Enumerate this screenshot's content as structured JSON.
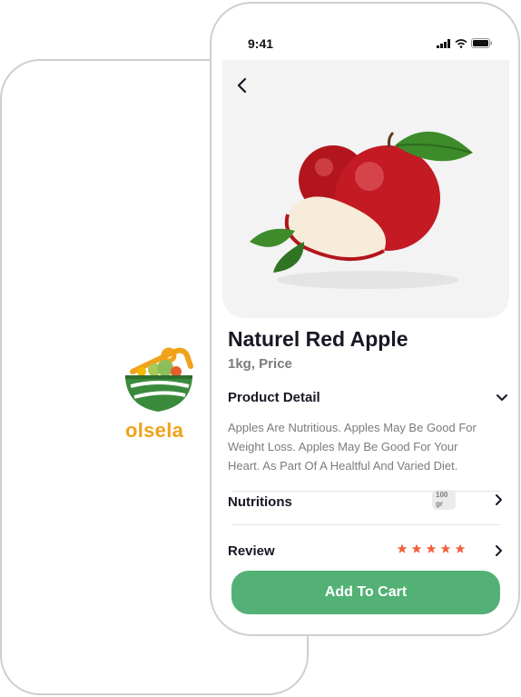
{
  "splash": {
    "brand": "olsela",
    "colors": {
      "brand_orange": "#f0a21a",
      "brand_green": "#3a8a3c"
    },
    "logo_icon": "basket-logo-icon"
  },
  "status_bar": {
    "time": "9:41",
    "icons": [
      "signal-icon",
      "wifi-icon",
      "battery-icon"
    ]
  },
  "product": {
    "name": "Naturel Red Apple",
    "unit_price": "1kg, Price",
    "detail_label": "Product Detail",
    "description": "Apples Are Nutritious. Apples May Be Good For Weight Loss. Apples May Be Good For Your Heart. As Part Of A Healtful And Varied Diet.",
    "nutritions_label": "Nutritions",
    "nutritions_badge": "100 gr",
    "review_label": "Review",
    "rating": 5
  },
  "actions": {
    "add_to_cart": "Add To Cart"
  },
  "colors": {
    "accent": "#53b175",
    "star": "#f3603f",
    "muted_text": "#7c7c7c"
  }
}
